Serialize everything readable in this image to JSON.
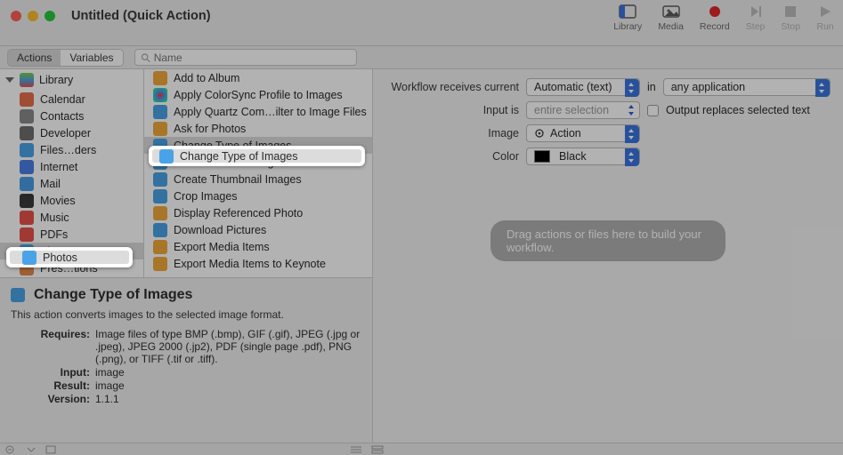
{
  "window": {
    "title": "Untitled (Quick Action)"
  },
  "toolbar": {
    "library": "Library",
    "media": "Media",
    "record": "Record",
    "step": "Step",
    "stop": "Stop",
    "run": "Run"
  },
  "tabs": {
    "actions": "Actions",
    "variables": "Variables"
  },
  "search": {
    "placeholder": "Name"
  },
  "library": {
    "header": "Library",
    "items": [
      "Calendar",
      "Contacts",
      "Developer",
      "Files…ders",
      "Internet",
      "Mail",
      "Movies",
      "Music",
      "PDFs",
      "Photos",
      "Pres…tions"
    ],
    "selected_index": 9
  },
  "actions": {
    "items": [
      "Add to Album",
      "Apply ColorSync Profile to Images",
      "Apply Quartz Com…ilter to Image Files",
      "Ask for Photos",
      "Change Type of Images",
      "Create Banner Image from Text",
      "Create Thumbnail Images",
      "Crop Images",
      "Display Referenced Photo",
      "Download Pictures",
      "Export Media Items",
      "Export Media Items to Keynote"
    ],
    "selected_index": 4
  },
  "workflow": {
    "receives_label": "Workflow receives current",
    "receives_value": "Automatic (text)",
    "in_label": "in",
    "in_value": "any application",
    "input_is_label": "Input is",
    "input_is_value": "entire selection",
    "output_replaces_label": "Output replaces selected text",
    "image_label": "Image",
    "image_value": "Action",
    "color_label": "Color",
    "color_value": "Black",
    "drop_hint": "Drag actions or files here to build your workflow."
  },
  "info": {
    "title": "Change Type of Images",
    "desc": "This action converts images to the selected image format.",
    "requires_k": "Requires:",
    "requires_v": "Image files of type BMP (.bmp), GIF (.gif), JPEG (.jpg or .jpeg), JPEG 2000 (.jp2), PDF (single page .pdf), PNG (.png), or TIFF (.tif or .tiff).",
    "input_k": "Input:",
    "input_v": "image",
    "result_k": "Result:",
    "result_v": "image",
    "version_k": "Version:",
    "version_v": "1.1.1"
  },
  "icons": {
    "lib_colors": [
      "#e66f4a",
      "#8a8a8a",
      "#6f6f6f",
      "#4aa3e6",
      "#4a7ee6",
      "#4a9de6",
      "#3a3a3a",
      "#e6524a",
      "#e6524a",
      "#4aa3e6",
      "#e68a4a"
    ],
    "action_color": "#4aa3e6"
  }
}
